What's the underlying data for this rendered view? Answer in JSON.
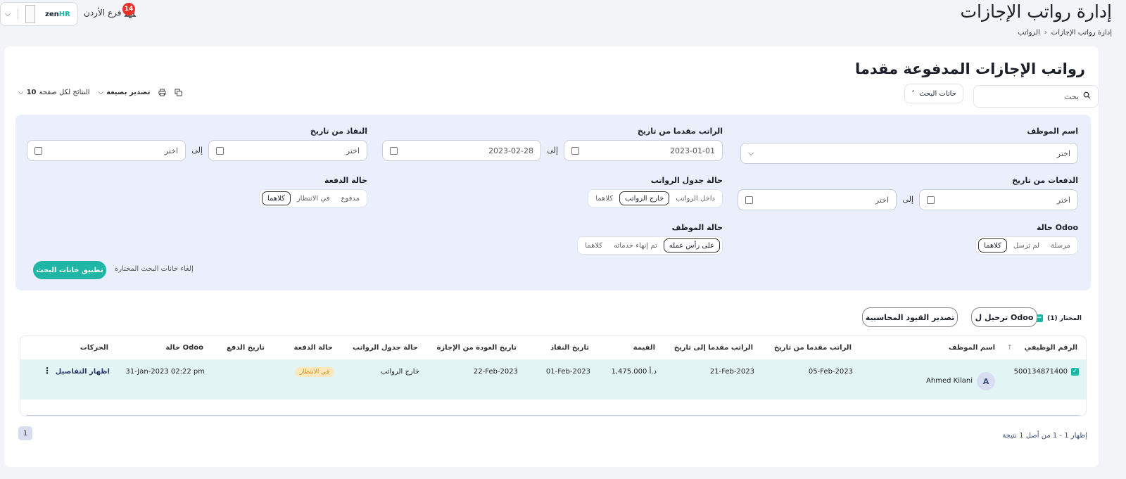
{
  "page": {
    "title": "إدارة رواتب الإجازات"
  },
  "breadcrumb": {
    "root": "الرواتب",
    "current": "إدارة رواتب الإجازات"
  },
  "header": {
    "branch": "فرع الأردن",
    "notifications": "14",
    "logo_a": "zen",
    "logo_b": "HR"
  },
  "card": {
    "title": "رواتب الإجازات المدفوعة مقدما"
  },
  "search": {
    "placeholder": "بحث"
  },
  "filter_toggle": "خانات البحث",
  "toolbar": {
    "export": "تصدير بصيغة",
    "per_page_label": "النتائج لكل صفحة",
    "per_page": "10"
  },
  "filters": {
    "employee_name": {
      "label": "اسم الموظف",
      "placeholder": "اختر"
    },
    "advance_from": {
      "label": "الراتب مقدما من تاريخ",
      "from": "2023-01-01",
      "to": "2023-02-28"
    },
    "effective_from": {
      "label": "النفاذ من تاريخ",
      "from": "اختر",
      "to": "اختر"
    },
    "to_word": "إلى",
    "payments_from": {
      "label": "الدفعات من تاريخ",
      "from": "اختر",
      "to": "اختر"
    },
    "payroll_status": {
      "label": "حالة جدول الرواتب",
      "options": [
        "داخل الرواتب",
        "خارج الرواتب",
        "كلاهما"
      ],
      "selected": "خارج الرواتب"
    },
    "payment_status": {
      "label": "حالة الدفعة",
      "options": [
        "مدفوع",
        "في الانتظار",
        "كلاهما"
      ],
      "selected": "كلاهما"
    },
    "odoo_status": {
      "label": "حالة Odoo",
      "options": [
        "مرسلة",
        "لم ترسل",
        "كلاهما"
      ],
      "selected": "كلاهما"
    },
    "employee_status": {
      "label": "حالة الموظف",
      "options": [
        "على رأس عمله",
        "تم إنهاء خدماته",
        "كلاهما"
      ],
      "selected": "على رأس عمله"
    },
    "apply": "تطبيق خانات البحث",
    "clear": "إلغاء خانات البحث المختارة"
  },
  "bulk": {
    "selected": "المختار (1)",
    "export_entries": "تصدير القيود المحاسبية",
    "post_odoo": "ترحيل ل Odoo"
  },
  "table": {
    "columns": [
      "الرقم الوظيفي",
      "اسم الموظف",
      "الراتب مقدما من تاريخ",
      "الراتب مقدما إلى تاريخ",
      "القيمة",
      "تاريخ النفاذ",
      "تاريخ العودة من الإجازة",
      "حالة جدول الرواتب",
      "حالة الدفعة",
      "تاريخ الدفع",
      "حالة Odoo",
      "الحركات"
    ],
    "rows": [
      {
        "id": "500134871400",
        "avatar": "A",
        "name": "Ahmed Kilani",
        "from": "05-Feb-2023",
        "to": "21-Feb-2023",
        "amount": "1,475.000 د.أ",
        "effective": "01-Feb-2023",
        "return": "22-Feb-2023",
        "payroll": "خارج الرواتب",
        "payment": "في الانتظار",
        "paid_date": "",
        "odoo": "31-Jan-2023 02:22 pm",
        "action": "اظهار التفاصيل"
      }
    ]
  },
  "pagination": {
    "page": "1",
    "summary": "إظهار 1 - 1 من أصل 1 نتيجة"
  },
  "colors": {
    "accent": "#1fb6a5",
    "filter_bg": "#ebeffc",
    "row_bg": "#e2f5f4",
    "badge": "#e8312d"
  }
}
